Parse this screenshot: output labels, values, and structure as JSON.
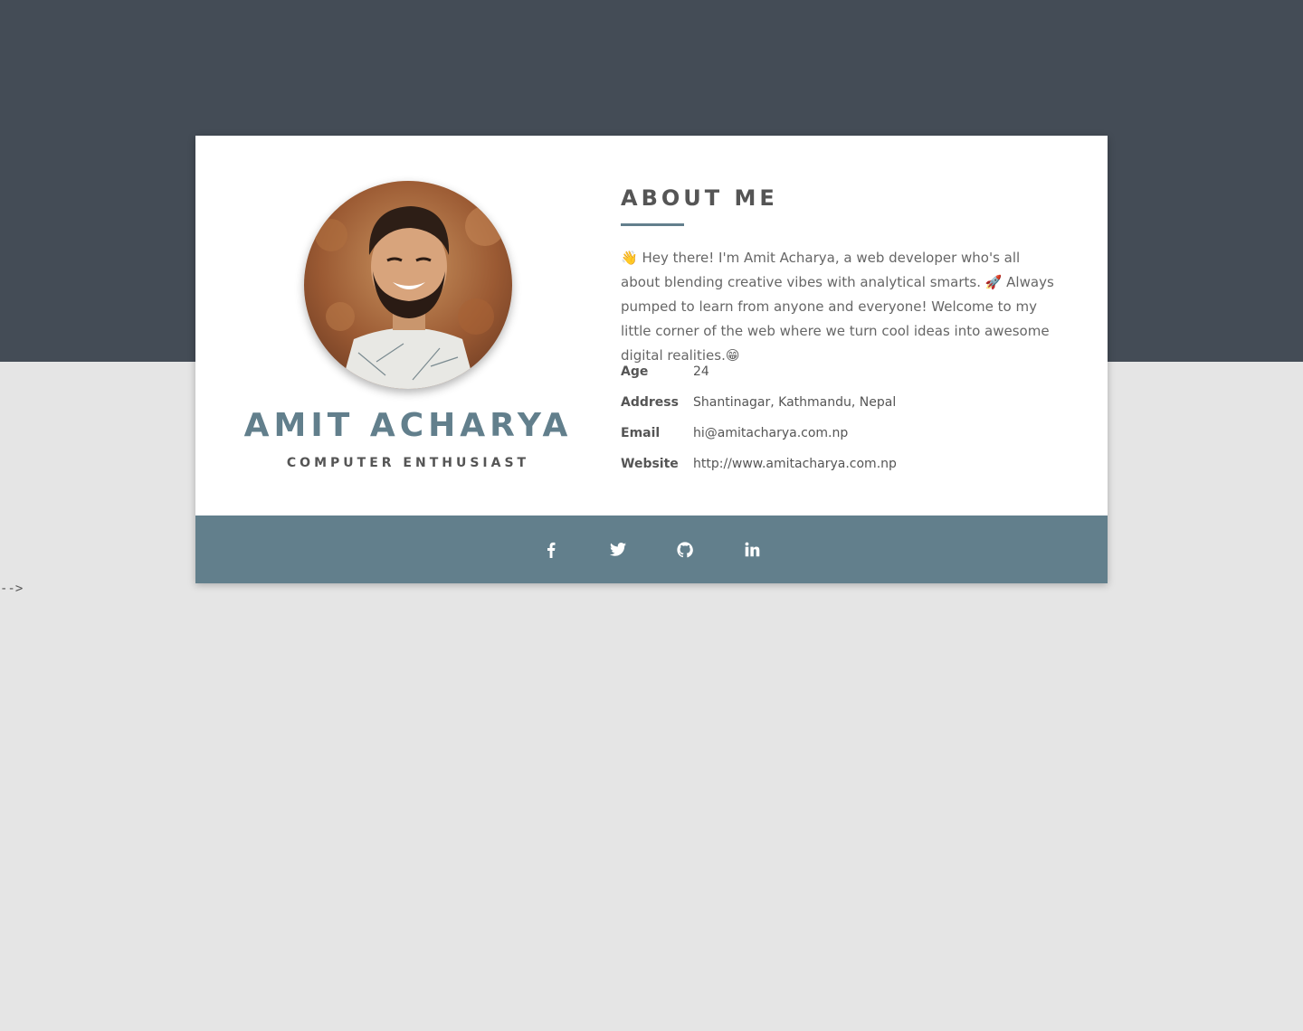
{
  "profile": {
    "name": "AMIT ACHARYA",
    "role": "COMPUTER ENTHUSIAST",
    "avatar_icon": "person-photo"
  },
  "about": {
    "title": "ABOUT ME",
    "bio": "👋 Hey there! I'm Amit Acharya, a web developer who's all about blending creative vibes with analytical smarts. 🚀 Always pumped to learn from anyone and everyone! Welcome to my little corner of the web where we turn cool ideas into awesome digital realities.😁"
  },
  "info": [
    {
      "label": "Age",
      "value": "24"
    },
    {
      "label": "Address",
      "value": "Shantinagar, Kathmandu, Nepal"
    },
    {
      "label": "Email",
      "value": "hi@amitacharya.com.np"
    },
    {
      "label": "Website",
      "value": "http://www.amitacharya.com.np"
    }
  ],
  "social": [
    {
      "icon": "facebook-icon"
    },
    {
      "icon": "twitter-icon"
    },
    {
      "icon": "github-icon"
    },
    {
      "icon": "linkedin-icon"
    }
  ],
  "stray_text": "-->",
  "colors": {
    "header_band": "#444c56",
    "page_bg": "#e5e5e5",
    "accent": "#627f8c",
    "card": "#ffffff"
  }
}
